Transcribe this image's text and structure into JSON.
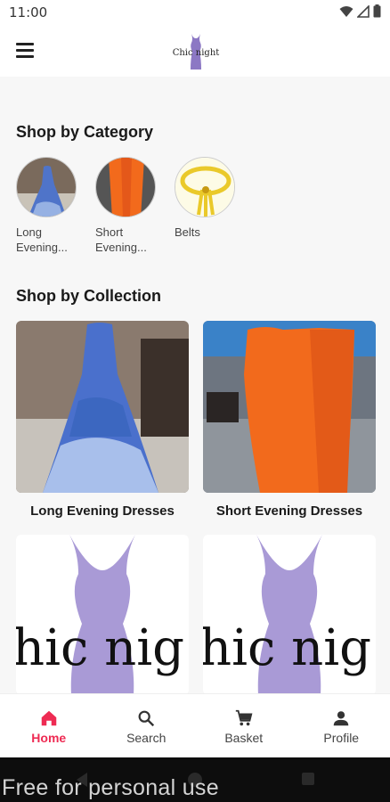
{
  "status_bar": {
    "time": "11:00"
  },
  "app_bar": {
    "logo_text": "Chic night"
  },
  "sections": {
    "category_title": "Shop by Category",
    "collection_title": "Shop by Collection"
  },
  "categories": [
    {
      "label": "Long Evening..."
    },
    {
      "label": "Short Evening..."
    },
    {
      "label": "Belts"
    }
  ],
  "collections": [
    {
      "label": "Long Evening Dresses"
    },
    {
      "label": "Short Evening Dresses"
    },
    {
      "label": "hic nig"
    },
    {
      "label": "hic nig"
    }
  ],
  "bottom_nav": {
    "items": [
      {
        "label": "Home",
        "icon": "home-icon",
        "active": true
      },
      {
        "label": "Search",
        "icon": "search-icon",
        "active": false
      },
      {
        "label": "Basket",
        "icon": "cart-icon",
        "active": false
      },
      {
        "label": "Profile",
        "icon": "person-icon",
        "active": false
      }
    ]
  },
  "watermark": "Free for personal use",
  "colors": {
    "accent": "#ee2b53",
    "background": "#f7f7f7"
  }
}
